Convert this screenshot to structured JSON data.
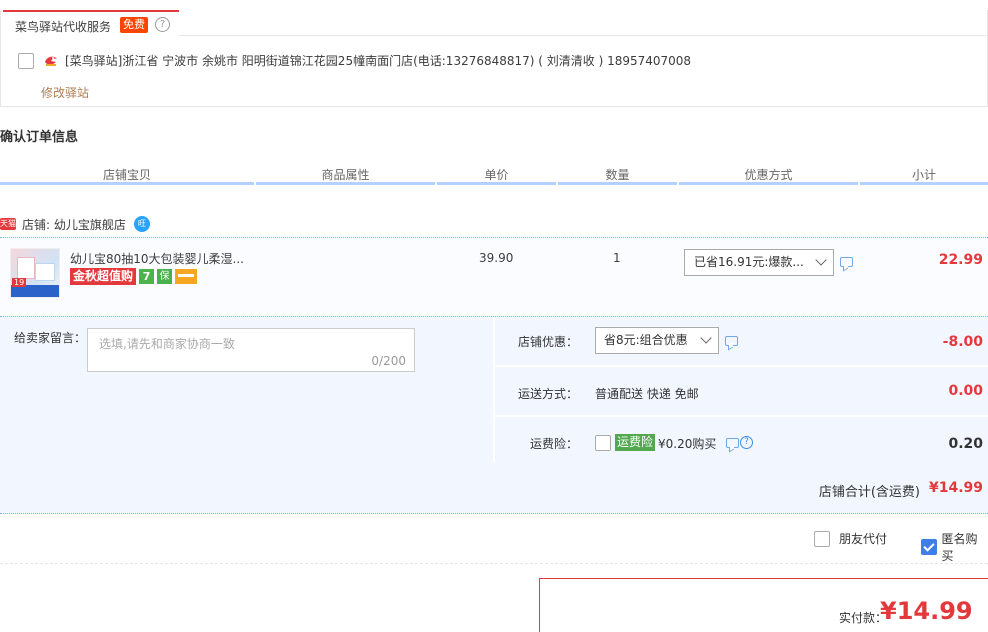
{
  "station": {
    "tab_label": "菜鸟驿站代收服务",
    "free_badge": "免费",
    "help_glyph": "?",
    "address": "[菜鸟驿站]浙江省 宁波市 余姚市 阳明街道锦江花园25幢南面门店(电话:13276848817) ( 刘清清收 ) 18957407008",
    "modify_link": "修改驿站"
  },
  "section_title": "确认订单信息",
  "table_headers": [
    "店铺宝贝",
    "商品属性",
    "单价",
    "数量",
    "优惠方式",
    "小计"
  ],
  "shop": {
    "badge": "天猫",
    "name": "店铺: 幼儿宝旗舰店",
    "icon_glyph": "旺"
  },
  "item": {
    "thumb_label": "19",
    "title": "幼儿宝80抽10大包装婴儿柔湿...",
    "promo_badge": "金秋超值购",
    "icon7": "7",
    "icon_bao": "保",
    "unit_price": "39.90",
    "quantity": "1",
    "discount": "已省16.91元:爆款...",
    "subtotal": "22.99"
  },
  "seller_message": {
    "label": "给卖家留言：",
    "placeholder": "选填,请先和商家协商一致",
    "count": "0/200"
  },
  "shop_discount": {
    "label": "店铺优惠：",
    "selected": "省8元:组合优惠",
    "amount": "-8.00"
  },
  "shipping": {
    "label": "运送方式：",
    "method": "普通配送 快递 免邮",
    "amount": "0.00"
  },
  "insurance": {
    "label": "运费险：",
    "badge": "运费险",
    "text": "¥0.20购买",
    "help_glyph": "?",
    "amount": "0.20"
  },
  "shop_total": {
    "label": "店铺合计(含运费)",
    "amount": "¥14.99"
  },
  "options": {
    "friend_pay": "朋友代付",
    "anonymous": "匿名购买"
  },
  "payment": {
    "label": "实付款：",
    "amount": "¥14.99"
  },
  "colors": {
    "accent_red": "#e4393c",
    "header_line": "#b2d1ff",
    "panel_bg": "#f2f7ff",
    "check_blue": "#3f7ee8",
    "insurance_green": "#53a74f"
  }
}
